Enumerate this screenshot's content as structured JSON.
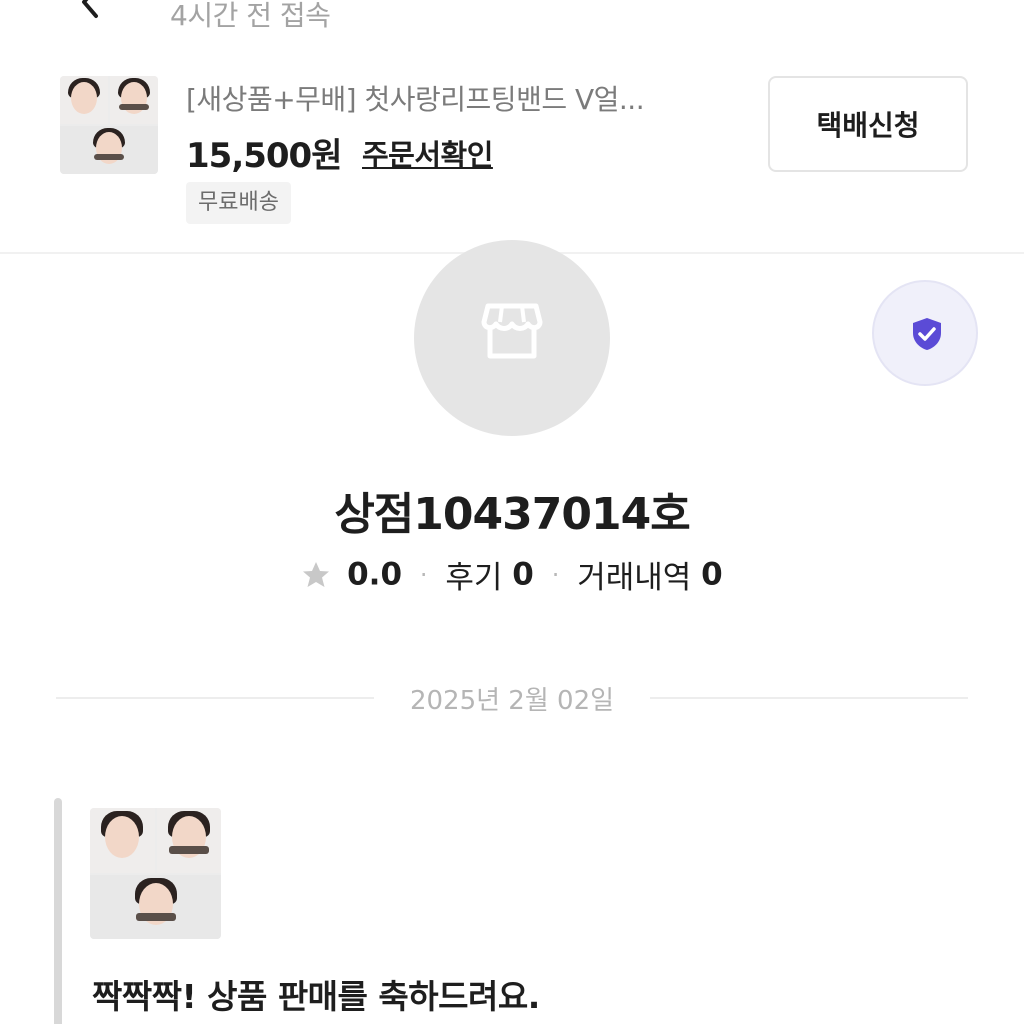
{
  "header": {
    "last_seen": "4시간 전 접속",
    "back_icon": "back-arrow-icon"
  },
  "product": {
    "title": "[새상품+무배] 첫사랑리프팅밴드 V얼...",
    "price": "15,500원",
    "order_link": "주문서확인",
    "shipping_badge": "무료배송",
    "delivery_button": "택배신청",
    "thumbnail_icon": "product-thumbnail"
  },
  "store": {
    "avatar_icon": "store-icon",
    "verified_icon": "shield-check-icon",
    "verified_color": "#5b4bd6",
    "name": "상점10437014호",
    "rating_icon": "star-icon",
    "rating": "0.0",
    "reviews_label": "후기",
    "reviews_count": "0",
    "trades_label": "거래내역",
    "trades_count": "0"
  },
  "chat": {
    "date": "2025년 2월 02일",
    "message_text": "짝짝짝! 상품 판매를 축하드려요."
  }
}
